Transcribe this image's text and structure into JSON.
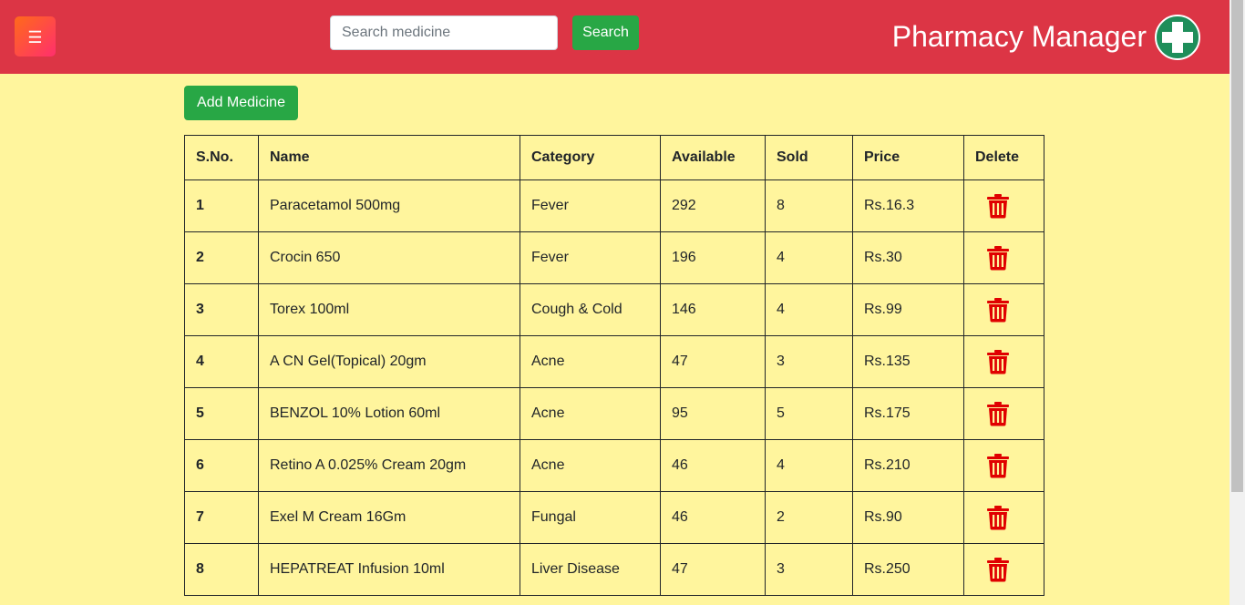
{
  "navbar": {
    "menu_icon": "☰",
    "search_placeholder": "Search medicine",
    "search_label": "Search",
    "brand": "Pharmacy Manager",
    "brand_logo_icon": "cross-icon",
    "color": "#dc3545"
  },
  "actions": {
    "add_label": "Add Medicine"
  },
  "table": {
    "headers": [
      "S.No.",
      "Name",
      "Category",
      "Available",
      "Sold",
      "Price",
      "Delete"
    ],
    "rows": [
      {
        "sno": "1",
        "name": "Paracetamol 500mg",
        "category": "Fever",
        "available": "292",
        "sold": "8",
        "price": "Rs.16.3"
      },
      {
        "sno": "2",
        "name": "Crocin 650",
        "category": "Fever",
        "available": "196",
        "sold": "4",
        "price": "Rs.30"
      },
      {
        "sno": "3",
        "name": "Torex 100ml",
        "category": "Cough & Cold",
        "available": "146",
        "sold": "4",
        "price": "Rs.99"
      },
      {
        "sno": "4",
        "name": "A CN Gel(Topical) 20gm",
        "category": "Acne",
        "available": "47",
        "sold": "3",
        "price": "Rs.135"
      },
      {
        "sno": "5",
        "name": "BENZOL 10% Lotion 60ml",
        "category": "Acne",
        "available": "95",
        "sold": "5",
        "price": "Rs.175"
      },
      {
        "sno": "6",
        "name": "Retino A 0.025% Cream 20gm",
        "category": "Acne",
        "available": "46",
        "sold": "4",
        "price": "Rs.210"
      },
      {
        "sno": "7",
        "name": "Exel M Cream 16Gm",
        "category": "Fungal",
        "available": "46",
        "sold": "2",
        "price": "Rs.90"
      },
      {
        "sno": "8",
        "name": "HEPATREAT Infusion 10ml",
        "category": "Liver Disease",
        "available": "47",
        "sold": "3",
        "price": "Rs.250"
      }
    ],
    "delete_icon": "trash-icon",
    "delete_color": "#e00000"
  },
  "page_background": "#fff59d",
  "accent_green": "#28a745"
}
